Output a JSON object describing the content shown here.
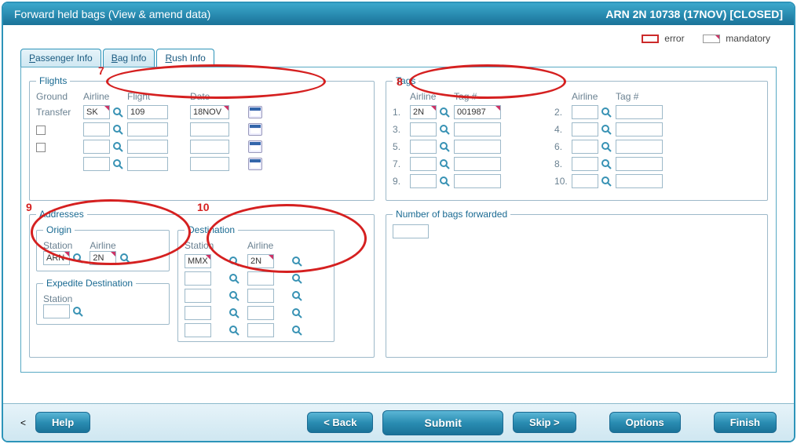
{
  "header": {
    "title": "Forward held bags (View & amend data)",
    "context": "ARN 2N 10738 (17NOV) [CLOSED]"
  },
  "legend": {
    "error": "error",
    "mandatory": "mandatory"
  },
  "tabs": {
    "passenger": "assenger Info",
    "bag": "ag Info",
    "rush": "ush Info"
  },
  "flights": {
    "legend": "Flights",
    "ground": "Ground",
    "transfer": "Transfer",
    "airline_hdr": "Airline",
    "flight_hdr": "Flight",
    "date_hdr": "Date",
    "rows": [
      {
        "airline": "SK",
        "flight": "109",
        "date": "18NOV"
      },
      {
        "airline": "",
        "flight": "",
        "date": ""
      },
      {
        "airline": "",
        "flight": "",
        "date": ""
      },
      {
        "airline": "",
        "flight": "",
        "date": ""
      }
    ]
  },
  "tags": {
    "legend": "Tags",
    "airline_hdr": "Airline",
    "tag_hdr": "Tag #",
    "rows": [
      {
        "n": "1.",
        "airline": "2N",
        "tag": "001987"
      },
      {
        "n": "2.",
        "airline": "",
        "tag": ""
      },
      {
        "n": "3.",
        "airline": "",
        "tag": ""
      },
      {
        "n": "4.",
        "airline": "",
        "tag": ""
      },
      {
        "n": "5.",
        "airline": "",
        "tag": ""
      },
      {
        "n": "6.",
        "airline": "",
        "tag": ""
      },
      {
        "n": "7.",
        "airline": "",
        "tag": ""
      },
      {
        "n": "8.",
        "airline": "",
        "tag": ""
      },
      {
        "n": "9.",
        "airline": "",
        "tag": ""
      },
      {
        "n": "10.",
        "airline": "",
        "tag": ""
      }
    ]
  },
  "addresses": {
    "legend": "Addresses",
    "origin": {
      "legend": "Origin",
      "station_hdr": "Station",
      "airline_hdr": "Airline",
      "station": "ARN",
      "airline": "2N"
    },
    "destination": {
      "legend": "Destination",
      "station_hdr": "Station",
      "airline_hdr": "Airline",
      "rows": [
        {
          "station": "MMX",
          "airline": "2N"
        },
        {
          "station": "",
          "airline": ""
        },
        {
          "station": "",
          "airline": ""
        },
        {
          "station": "",
          "airline": ""
        },
        {
          "station": "",
          "airline": ""
        }
      ]
    },
    "expedite": {
      "legend": "Expedite Destination",
      "station_hdr": "Station",
      "station": ""
    }
  },
  "numbags": {
    "legend": "Number of bags forwarded",
    "value": ""
  },
  "callouts": {
    "c7": "7",
    "c8": "8",
    "c9": "9",
    "c10": "10"
  },
  "buttons": {
    "help": "Help",
    "back": "< Back",
    "submit": "Submit",
    "skip": "Skip >",
    "options": "Options",
    "finish": "Finish"
  }
}
